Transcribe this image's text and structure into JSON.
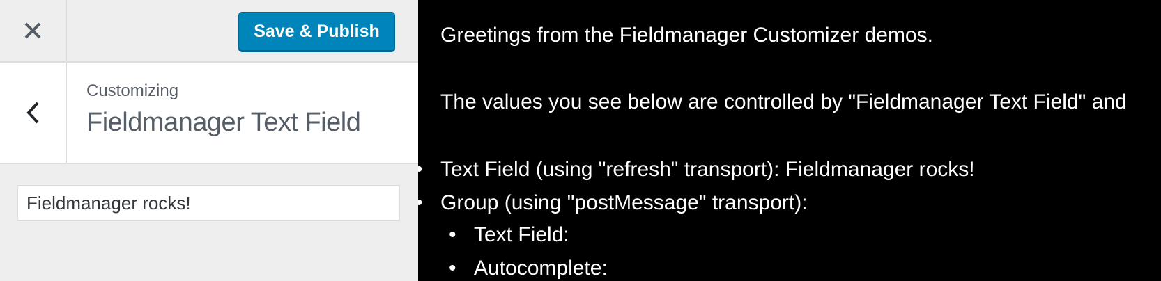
{
  "sidebar": {
    "publish_label": "Save & Publish",
    "crumb": "Customizing",
    "section_title": "Fieldmanager Text Field",
    "text_field_value": "Fieldmanager rocks!"
  },
  "preview": {
    "greeting": "Greetings from the Fieldmanager Customizer demos.",
    "description": "The values you see below are controlled by \"Fieldmanager Text Field\" and",
    "items": [
      "Text Field (using \"refresh\" transport): Fieldmanager rocks!",
      "Group (using \"postMessage\" transport):"
    ],
    "sub_items": [
      "Text Field:",
      "Autocomplete:"
    ]
  },
  "colors": {
    "publish_button": "#0085ba",
    "sidebar_bg": "#eeeeee",
    "preview_bg": "#000000"
  },
  "icons": {
    "close": "close-icon",
    "back": "chevron-left-icon"
  }
}
